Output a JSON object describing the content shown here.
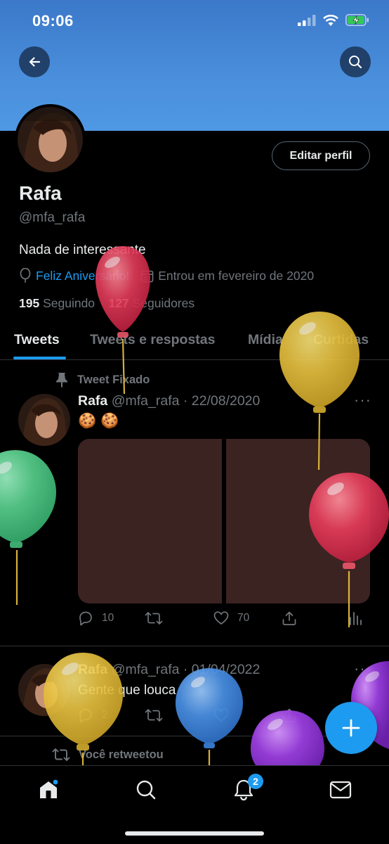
{
  "status_bar": {
    "time": "09:06"
  },
  "profile": {
    "name": "Rafa",
    "handle": "@mfa_rafa",
    "bio": "Nada de interessante",
    "birthday": "Feliz Aniversário!",
    "joined": "Entrou em fevereiro de 2020",
    "following_count": "195",
    "following_label": "Seguindo",
    "followers_count": "127",
    "followers_label": "Seguidores",
    "edit_button": "Editar perfil"
  },
  "tabs": [
    {
      "label": "Tweets",
      "active": true
    },
    {
      "label": "Tweets e respostas",
      "active": false
    },
    {
      "label": "Mídia",
      "active": false
    },
    {
      "label": "Curtidas",
      "active": false
    }
  ],
  "pinned_tweet": {
    "pinned_label": "Tweet Fixado",
    "name": "Rafa",
    "handle_date": "@mfa_rafa · 22/08/2020",
    "text": "🍪 🍪",
    "replies": "10",
    "likes": "70"
  },
  "tweet2": {
    "name": "Rafa",
    "handle_date": "@mfa_rafa · 01/04/2022",
    "text": "Gente que louca",
    "replies": "2"
  },
  "retweet_label": "Você retweetou",
  "bottom_nav": {
    "notifications_badge": "2"
  },
  "colors": {
    "accent": "#1d9bf0",
    "background": "#000000",
    "banner": "#4a8fdc"
  },
  "icons": [
    "back-arrow-icon",
    "search-icon",
    "balloon-icon",
    "calendar-icon",
    "pin-icon",
    "more-icon",
    "reply-icon",
    "retweet-icon",
    "like-icon",
    "share-icon",
    "analytics-icon",
    "compose-plus-icon",
    "home-icon",
    "notifications-bell-icon",
    "messages-icon"
  ]
}
